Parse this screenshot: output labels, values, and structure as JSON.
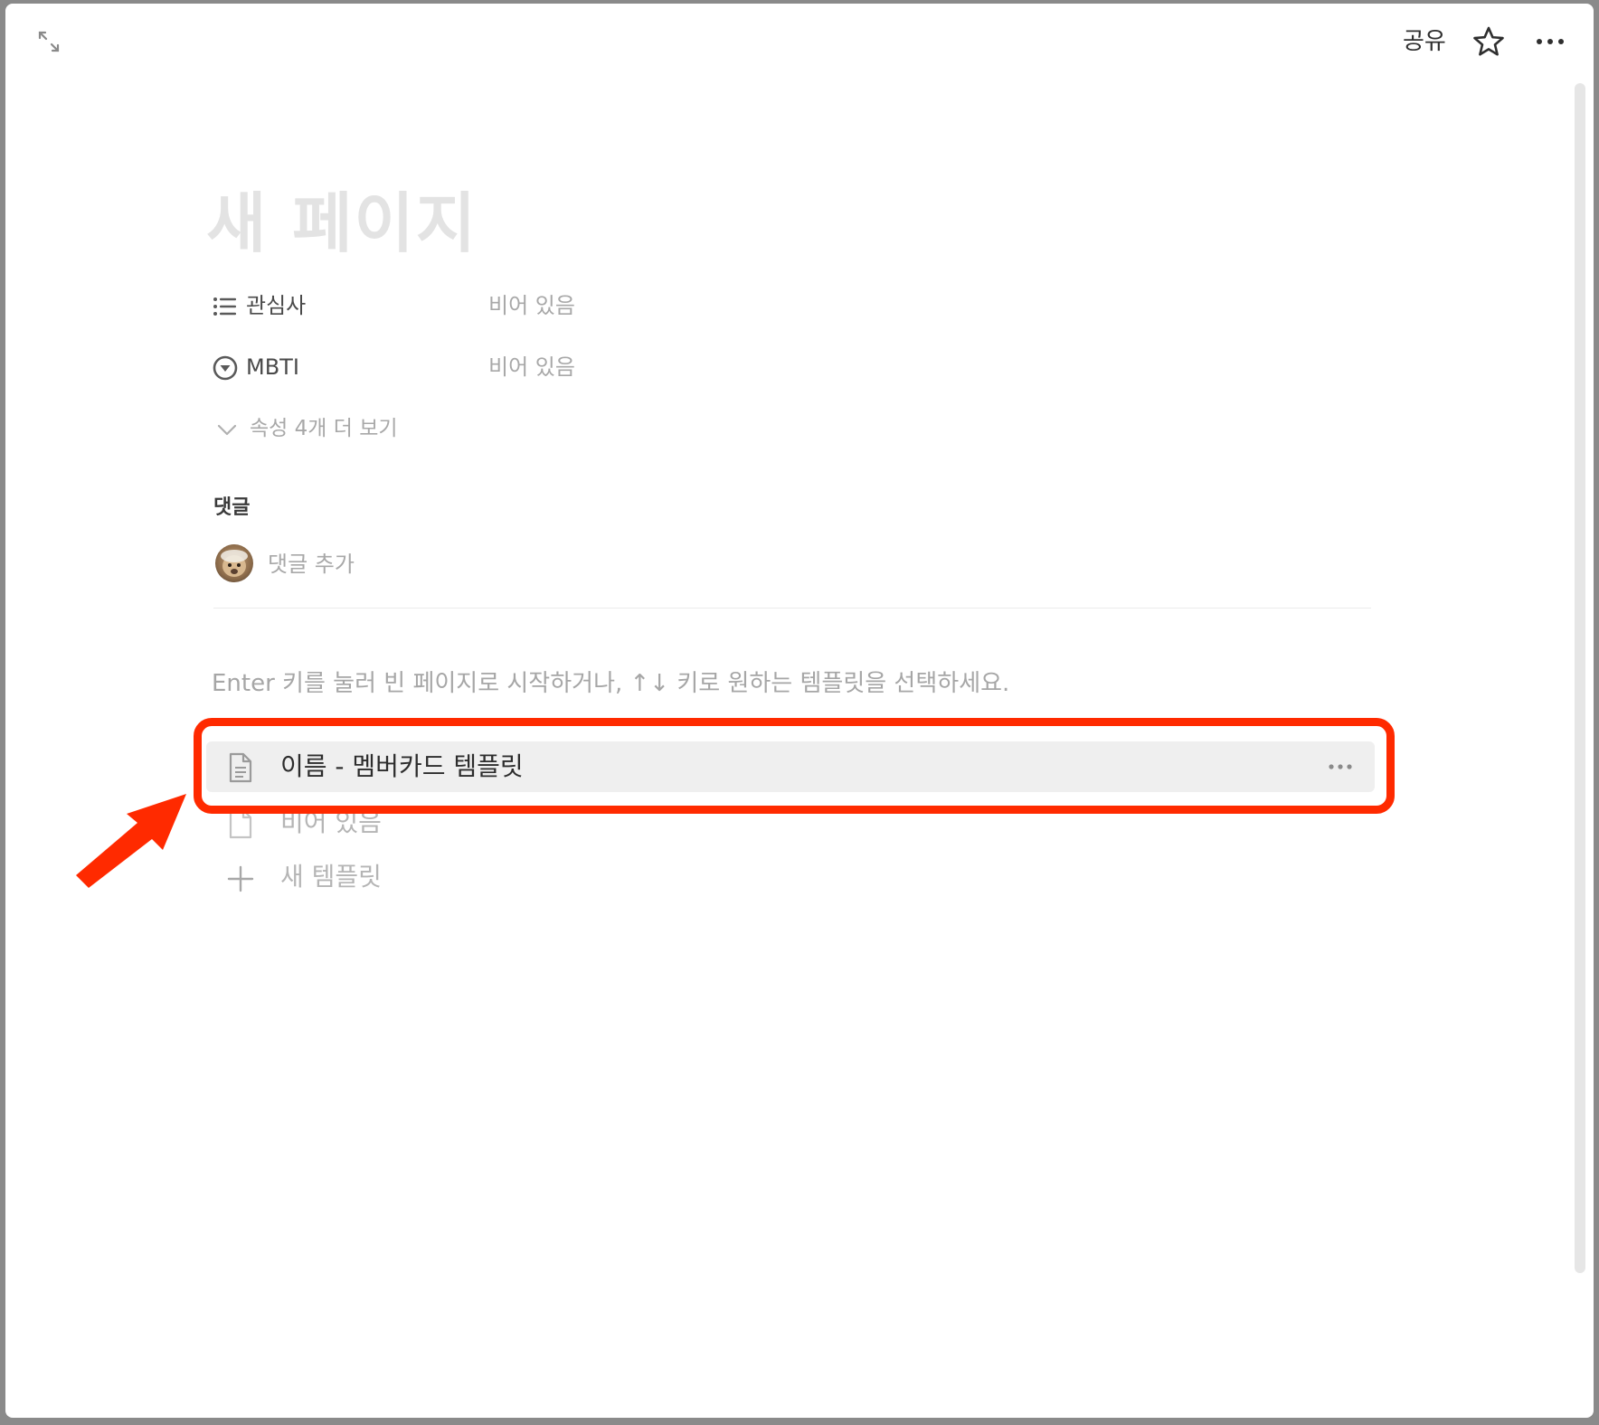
{
  "topbar": {
    "share_label": "공유",
    "expand_icon": "expand-arrows-icon",
    "favorite_icon": "star-icon",
    "more_icon": "ellipsis-icon"
  },
  "page": {
    "title_placeholder": "새 페이지"
  },
  "properties": [
    {
      "icon": "list-icon",
      "label": "관심사",
      "value": "비어 있음"
    },
    {
      "icon": "select-icon",
      "label": "MBTI",
      "value": "비어 있음"
    }
  ],
  "more_properties_label": "속성 4개 더 보기",
  "comments": {
    "heading": "댓글",
    "add_placeholder": "댓글 추가"
  },
  "template_hint": "Enter 키를 눌러 빈 페이지로 시작하거나, ↑↓ 키로 원하는 템플릿을 선택하세요.",
  "templates": {
    "items": [
      {
        "label": "이름 - 멤버카드 템플릿",
        "selected": true
      },
      {
        "label": "비어 있음",
        "selected": false
      }
    ],
    "new_label": "새 템플릿"
  },
  "colors": {
    "annotation": "#ff2a00",
    "selected_row": "#efefef"
  }
}
